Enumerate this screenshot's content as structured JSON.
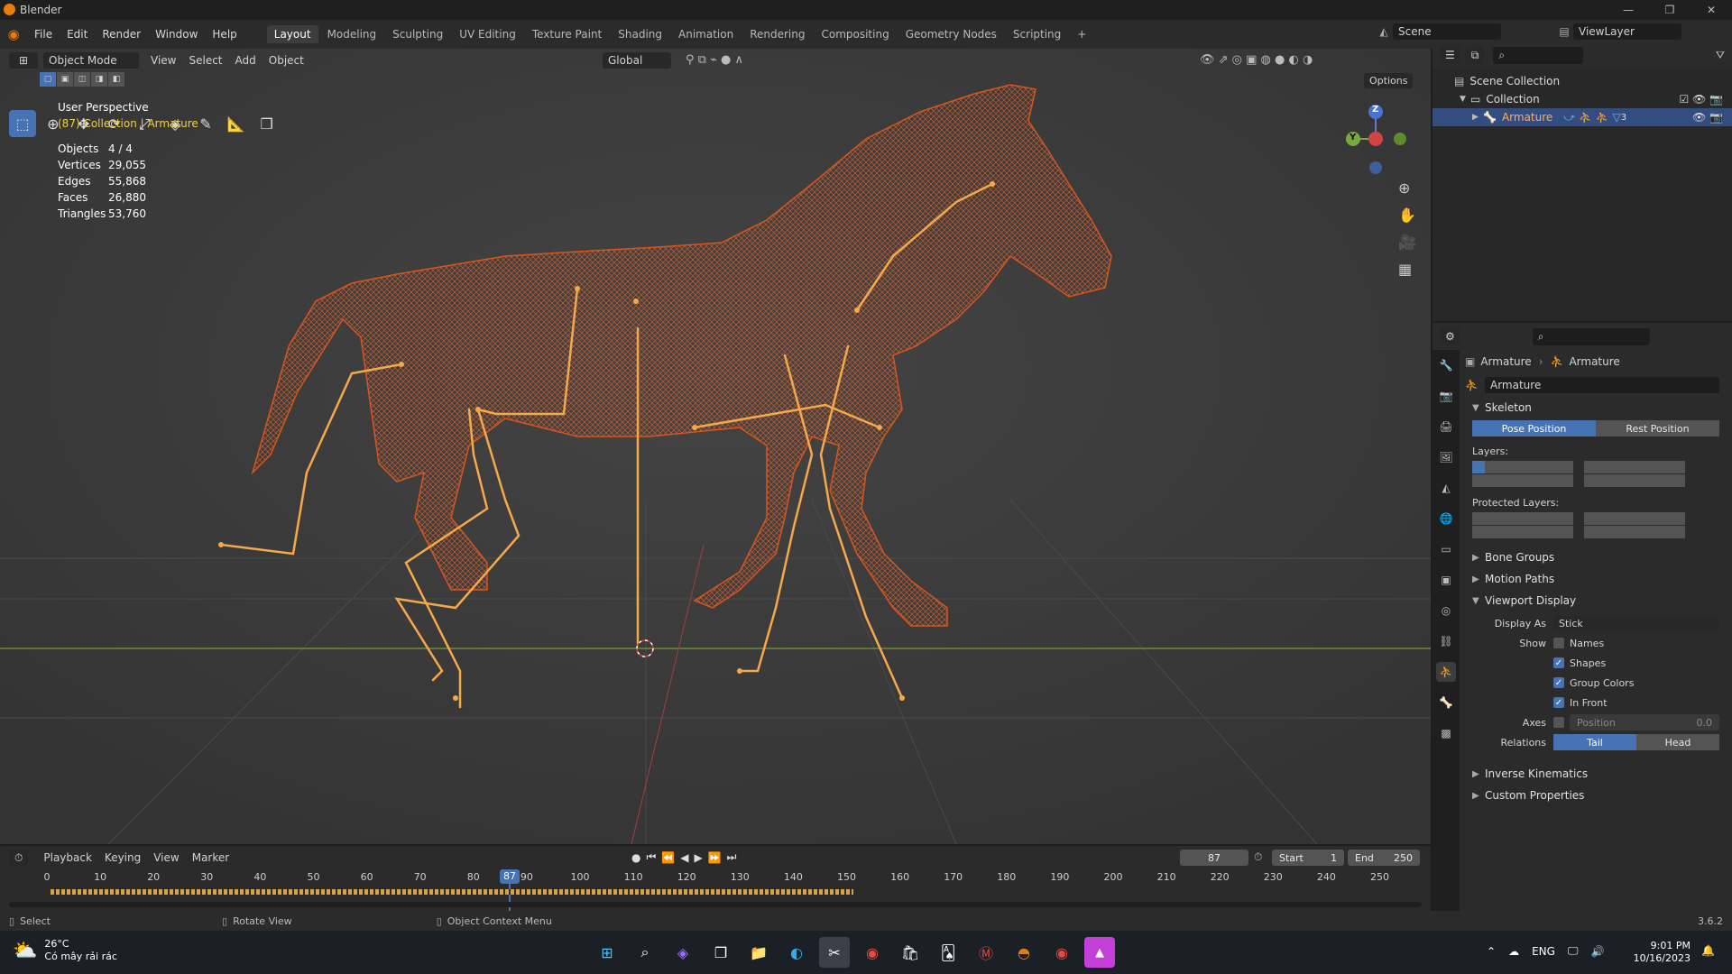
{
  "window": {
    "title": "Blender",
    "min": "—",
    "max": "❐",
    "close": "✕"
  },
  "menu": {
    "file": "File",
    "edit": "Edit",
    "render": "Render",
    "window": "Window",
    "help": "Help"
  },
  "workspace_tabs": [
    {
      "label": "Layout"
    },
    {
      "label": "Modeling"
    },
    {
      "label": "Sculpting"
    },
    {
      "label": "UV Editing"
    },
    {
      "label": "Texture Paint"
    },
    {
      "label": "Shading"
    },
    {
      "label": "Animation"
    },
    {
      "label": "Rendering"
    },
    {
      "label": "Compositing"
    },
    {
      "label": "Geometry Nodes"
    },
    {
      "label": "Scripting"
    }
  ],
  "add_workspace": "+",
  "scene": {
    "label": "Scene"
  },
  "viewlayer": {
    "label": "ViewLayer"
  },
  "viewport_header": {
    "mode": "Object Mode",
    "view": "View",
    "select": "Select",
    "add": "Add",
    "object": "Object",
    "orientation": "Global",
    "options": "Options"
  },
  "overlay": {
    "perspective": "User Perspective",
    "collection": "(87) Collection | Armature",
    "stats": [
      {
        "k": "Objects",
        "v": "4 / 4"
      },
      {
        "k": "Vertices",
        "v": "29,055"
      },
      {
        "k": "Edges",
        "v": "55,868"
      },
      {
        "k": "Faces",
        "v": "26,880"
      },
      {
        "k": "Triangles",
        "v": "53,760"
      }
    ]
  },
  "gizmo": {
    "z": "Z",
    "y": "Y"
  },
  "outliner": {
    "scene_collection": "Scene Collection",
    "collection": "Collection",
    "armature": "Armature",
    "armature_count": "3"
  },
  "properties": {
    "breadcrumb_obj": "Armature",
    "breadcrumb_data": "Armature",
    "data_name": "Armature",
    "skeleton": "Skeleton",
    "pose_position": "Pose Position",
    "rest_position": "Rest Position",
    "layers": "Layers:",
    "protected_layers": "Protected Layers:",
    "bone_groups": "Bone Groups",
    "motion_paths": "Motion Paths",
    "viewport_display": "Viewport Display",
    "display_as_label": "Display As",
    "display_as_value": "Stick",
    "show_label": "Show",
    "names": "Names",
    "shapes": "Shapes",
    "group_colors": "Group Colors",
    "in_front": "In Front",
    "axes_label": "Axes",
    "position_label": "Position",
    "position_value": "0.0",
    "relations_label": "Relations",
    "tail": "Tail",
    "head": "Head",
    "inverse_kinematics": "Inverse Kinematics",
    "custom_properties": "Custom Properties"
  },
  "timeline": {
    "playback": "Playback",
    "keying": "Keying",
    "view": "View",
    "marker": "Marker",
    "current_frame": "87",
    "start_label": "Start",
    "start": "1",
    "end_label": "End",
    "end": "250",
    "ticks": [
      "0",
      "10",
      "20",
      "30",
      "40",
      "50",
      "60",
      "70",
      "80",
      "90",
      "100",
      "110",
      "120",
      "130",
      "140",
      "150",
      "160",
      "170",
      "180",
      "190",
      "200",
      "210",
      "220",
      "230",
      "240",
      "250"
    ]
  },
  "statusbar": {
    "select": "Select",
    "rotate": "Rotate View",
    "context": "Object Context Menu",
    "version": "3.6.2"
  },
  "taskbar": {
    "temp": "26°C",
    "weather": "Có mây rải rác",
    "lang": "ENG",
    "time": "9:01 PM",
    "date": "10/16/2023"
  },
  "colors": {
    "accent": "#4772b3",
    "wire": "#e0602a",
    "bone": "#f5a94a",
    "selected_text": "#ffae54"
  }
}
